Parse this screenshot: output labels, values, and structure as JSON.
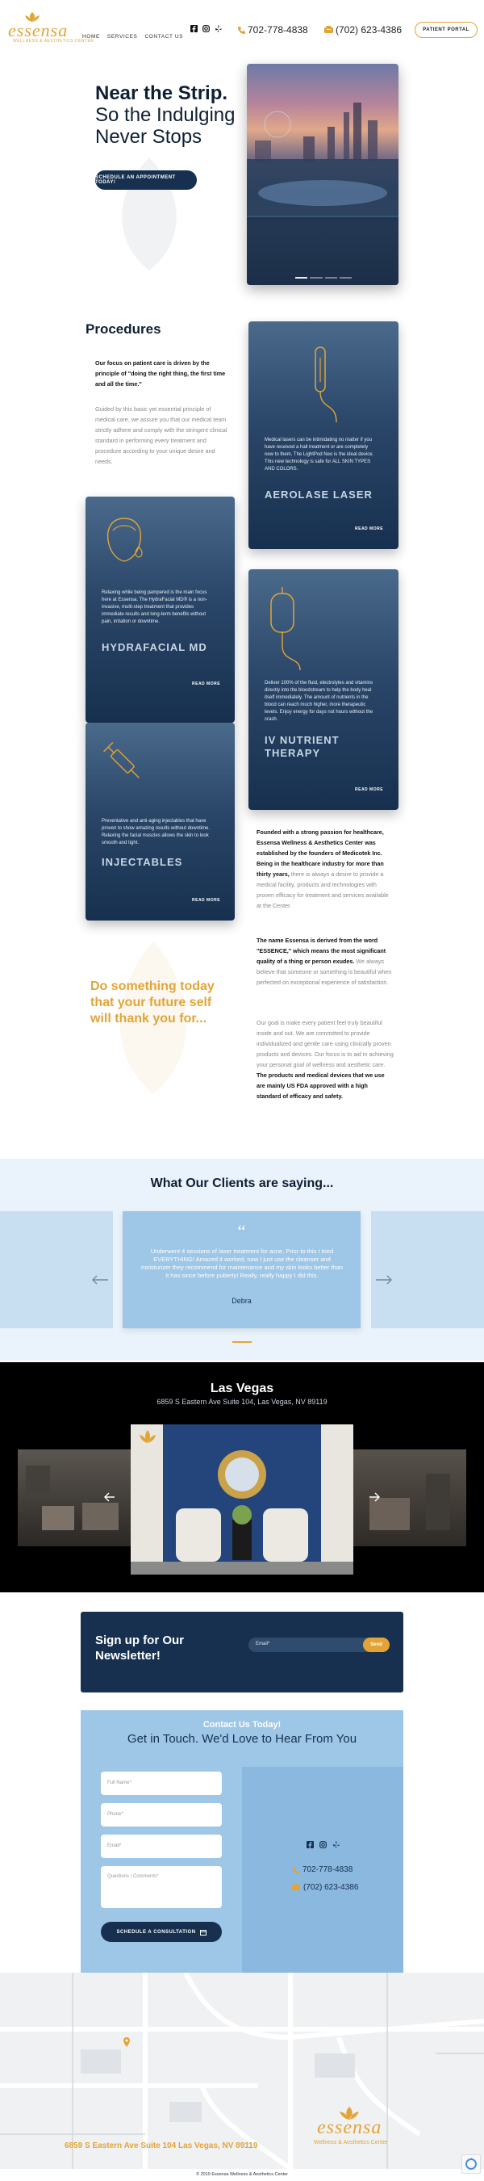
{
  "header": {
    "logo_word": "essensa",
    "logo_sub": "Wellness & Aesthetics Center",
    "nav": [
      "HOME",
      "SERVICES",
      "CONTACT US"
    ],
    "phone1": "702-778-4838",
    "phone2": "(702) 623-4386",
    "portal_label": "PATIENT PORTAL"
  },
  "hero": {
    "title_bold": "Near the Strip.",
    "title_line2": "So the Indulging",
    "title_line3": "Never Stops",
    "cta": "SCHEDULE AN APPOINTMENT TODAY!"
  },
  "procedures": {
    "heading": "Procedures",
    "intro_bold": "Our focus on patient care is driven by the principle of \"doing the right thing, the first time and all the time.\"",
    "intro_text": "Guided by this basic yet essential principle of medical care, we assure you that our medical team strictly adhere and comply with the stringent clinical standard in performing every treatment and procedure according to your unique desire and needs.",
    "cards": [
      {
        "title": "AEROLASE LASER",
        "text": "Medical lasers can be intimidating no matter if you have received a hall treatment or are completely new to them. The LightPod Neo is the ideal device. This new technology is safe for ALL SKIN TYPES AND COLORS.",
        "read_more": "READ MORE"
      },
      {
        "title": "HYDRAFACIAL MD",
        "text": "Relaxing while being pampered is the main focus here at Essensa. The HydraFacial MD® is a non-invasive, multi-step treatment that provides immediate results and long-term benefits without pain, irritation or downtime.",
        "read_more": "READ MORE"
      },
      {
        "title": "IV NUTRIENT THERAPY",
        "text": "Deliver 100% of the fluid, electrolytes and vitamins directly into the bloodstream to help the body heal itself immediately. The amount of nutrients in the blood can reach much higher, more therapeutic levels. Enjoy energy for days not hours without the crash.",
        "read_more": "READ MORE"
      },
      {
        "title": "INJECTABLES",
        "text": "Preventative and anti-aging injectables that have proven to show amazing results without downtime. Relaxing the facial muscles allows the skin to look smooth and tight.",
        "read_more": "READ MORE"
      }
    ],
    "p1_bold": "Founded with a strong passion for healthcare, Essensa Wellness & Aesthetics Center was established by the founders of Medicotek Inc. Being in the healthcare industry for more than thirty years,",
    "p1_text": "there is always a desire to provide a medical facility, products and technologies with proven efficacy for treatment and services available at the Center.",
    "p2_bold": "The name Essensa is derived from the word \"ESSENCE,\" which means the most significant quality of a thing or person exudes.",
    "p2_text": "We always believe that someone or something is beautiful when perfected on exceptional experience of satisfaction.",
    "p3_text": "Our goal is make every patient feel truly beautiful inside and out. We are committed to provide individualized and gentle care using clinically proven products and devices. Our focus is to aid in achieving your personal goal of wellness and aesthetic care.",
    "p3_bold": "The products and medical devices that we use are mainly US FDA approved with a high standard of efficacy and safety.",
    "quote": "Do something today that your future self will thank you for..."
  },
  "testimonials": {
    "heading": "What Our Clients are saying...",
    "quote": "Underwent 4 sessions of laser treatment for acne. Prior to this I tried EVERYTHING! Amazed it worked, now I just use the cleanser and moisturizer they recommend for maintenance and my skin looks better than it has since before puberty! Really, really happy I did this.",
    "author": "Debra"
  },
  "location": {
    "city": "Las Vegas",
    "address": "6859 S Eastern Ave Suite 104, Las Vegas, NV 89119"
  },
  "newsletter": {
    "title_line1": "Sign up for Our",
    "title_line2": "Newsletter!",
    "email_placeholder": "Email*",
    "send": "Send"
  },
  "contact": {
    "eyebrow": "Contact Us Today!",
    "heading": "Get in Touch. We'd Love to Hear From You",
    "fields": [
      "Full Name*",
      "Phone*",
      "Email*",
      "Questions / Comments*"
    ],
    "submit": "SCHEDULE A CONSULTATION",
    "phone1": "702-778-4838",
    "phone2": "(702) 623-4386"
  },
  "footer": {
    "address": "6859 S Eastern Ave Suite 104 Las Vegas, NV 89119",
    "copyright": "© 2019 Essensa Wellness & Aesthetics Center",
    "logo_word": "essensa",
    "logo_sub": "Wellness & Aesthetics Center"
  },
  "colors": {
    "gold": "#e3a436",
    "navy": "#17304f",
    "light_blue": "#9ec6e6"
  }
}
